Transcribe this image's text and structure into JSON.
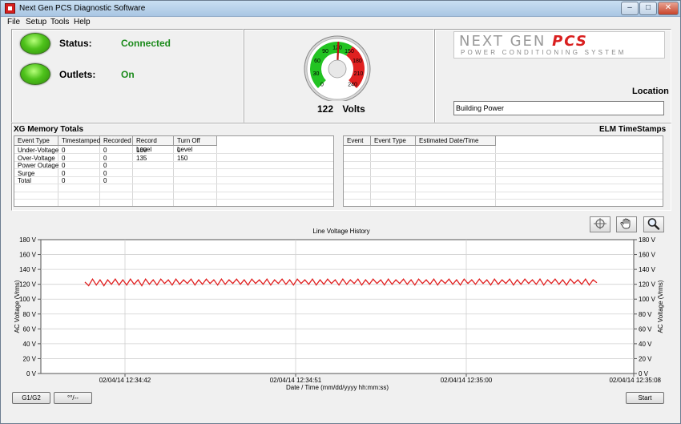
{
  "window": {
    "title": "Next Gen PCS Diagnostic Software"
  },
  "menu": [
    "File",
    "Setup",
    "Tools",
    "Help"
  ],
  "status": {
    "label": "Status:",
    "value": "Connected",
    "color": "#1a8a1a"
  },
  "outlets": {
    "label": "Outlets:",
    "value": "On",
    "color": "#1a8a1a"
  },
  "gauge": {
    "value": 122,
    "unit": "Volts",
    "min": 0,
    "max": 240,
    "ticks": [
      "0",
      "30",
      "60",
      "90",
      "120",
      "150",
      "180",
      "210",
      "240"
    ],
    "green_range": [
      0,
      150
    ],
    "red_range": [
      150,
      240
    ]
  },
  "logo": {
    "main": "NEXT GEN ",
    "accent": "PCS",
    "tagline": "POWER CONDITIONING SYSTEM"
  },
  "location": {
    "label": "Location",
    "value": "Building Power"
  },
  "memory_totals": {
    "title": "XG Memory Totals",
    "columns": [
      "Event Type",
      "Timestamped",
      "Recorded",
      "Record Level",
      "Turn Off Level"
    ],
    "rows": [
      [
        "Under-Voltage",
        "0",
        "0",
        "100",
        "0"
      ],
      [
        "Over-Voltage",
        "0",
        "0",
        "135",
        "150"
      ],
      [
        "Power Outage",
        "0",
        "0",
        "",
        ""
      ],
      [
        "Surge",
        "0",
        "0",
        "",
        ""
      ],
      [
        "Total",
        "0",
        "0",
        "",
        ""
      ]
    ]
  },
  "elm": {
    "title": "ELM TimeStamps",
    "columns": [
      "Event",
      "Event Type",
      "Estimated Date/Time"
    ]
  },
  "toolbar": {
    "crosshair": "crosshair-icon",
    "pan": "hand-icon",
    "zoom": "magnifier-icon"
  },
  "chart_data": {
    "type": "line",
    "title": "Line Voltage History",
    "xlabel": "Date / Time (mm/dd/yyyy hh:mm:ss)",
    "ylabel": "AC Voltage (Vrms)",
    "ylabel_right": "AC Voltage (Vrms)",
    "ylim": [
      0,
      180
    ],
    "yticks": [
      "0 V",
      "20 V",
      "40 V",
      "60 V",
      "80 V",
      "100 V",
      "120 V",
      "140 V",
      "160 V",
      "180 V"
    ],
    "xticks": [
      "02/04/14 12:34:42",
      "02/04/14 12:34:51",
      "02/04/14 12:35:00",
      "02/04/14 12:35:08"
    ],
    "grid": true,
    "series": [
      {
        "color": "#e02020",
        "values": [
          123,
          118,
          127,
          119,
          126,
          118,
          126,
          120,
          127,
          119,
          126,
          119,
          127,
          120,
          126,
          118,
          127,
          120,
          126,
          119,
          127,
          121,
          126,
          119,
          127,
          120,
          126,
          121,
          127,
          119,
          126,
          120,
          127,
          121,
          126,
          119,
          127,
          120,
          126,
          121,
          127,
          120,
          126,
          119,
          127,
          121,
          126,
          120,
          127,
          119,
          126,
          121,
          127,
          120,
          126,
          119,
          127,
          121,
          126,
          120,
          127,
          119,
          126,
          120,
          127,
          121,
          126,
          119,
          127,
          120,
          126,
          121,
          127,
          119,
          126,
          120,
          127,
          121,
          126,
          119,
          127,
          120,
          126,
          121,
          127,
          120,
          126,
          119,
          127,
          121,
          126,
          120,
          127,
          119,
          126,
          121,
          127,
          120,
          126,
          119,
          127,
          121,
          126,
          120,
          127,
          121,
          126,
          119,
          127,
          120,
          126,
          121,
          127,
          119,
          126,
          120,
          127,
          121,
          126,
          120,
          127,
          119,
          126,
          121,
          127,
          120,
          126,
          119,
          127,
          121,
          126,
          120,
          127,
          119,
          126,
          122
        ]
      }
    ]
  },
  "buttons": {
    "g1g2": "G1/G2",
    "units": "°°/--",
    "start": "Start"
  }
}
